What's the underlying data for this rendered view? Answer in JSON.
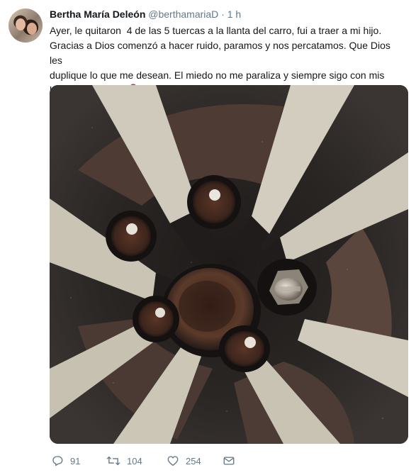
{
  "tweet": {
    "author_name": "Bertha María Deleón",
    "author_handle": "@berthamariaD",
    "separator": "·",
    "time": "1 h",
    "text": "Ayer, le quitaron  4 de las 5 tuercas a la llanta del carro, fui a traer a mi hijo.\nGracias a Dios comenzó a hacer ruido, paramos y nos percatamos. Que Dios les\nduplique lo que me desean. El miedo no me paraliza y siempre sigo con mis\nluchas. Feliz día !",
    "emoji_icon": "balloon-icon",
    "photo_icon": "wheel-photo"
  },
  "actions": {
    "reply_count": "91",
    "retweet_count": "104",
    "like_count": "254"
  },
  "colors": {
    "text": "#14171a",
    "muted": "#657786",
    "balloon": "#e0245e"
  }
}
